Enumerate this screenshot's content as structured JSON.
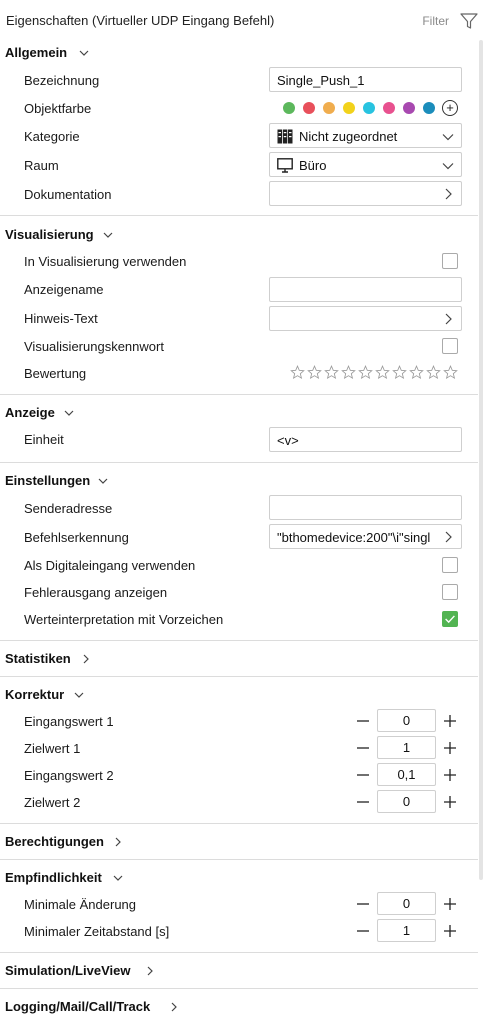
{
  "header": {
    "title": "Eigenschaften (Virtueller UDP Eingang Befehl)",
    "filter_label": "Filter"
  },
  "sections": {
    "allgemein": {
      "title": "Allgemein",
      "bezeichnung_label": "Bezeichnung",
      "bezeichnung_value": "Single_Push_1",
      "objektfarbe_label": "Objektfarbe",
      "colors": [
        "#5cb85c",
        "#e8505b",
        "#f0ad4e",
        "#f2d21b",
        "#28c3e0",
        "#e8518f",
        "#a849b0",
        "#1b8dbb"
      ],
      "kategorie_label": "Kategorie",
      "kategorie_value": "Nicht zugeordnet",
      "raum_label": "Raum",
      "raum_value": "Büro",
      "dokumentation_label": "Dokumentation"
    },
    "visualisierung": {
      "title": "Visualisierung",
      "in_vis_label": "In Visualisierung verwenden",
      "anzeigename_label": "Anzeigename",
      "hinweis_label": "Hinweis-Text",
      "kennwort_label": "Visualisierungskennwort",
      "bewertung_label": "Bewertung",
      "stars_total": 10,
      "stars_filled": 0
    },
    "anzeige": {
      "title": "Anzeige",
      "einheit_label": "Einheit",
      "einheit_value": "<v>"
    },
    "einstellungen": {
      "title": "Einstellungen",
      "senderadresse_label": "Senderadresse",
      "befehlserkennung_label": "Befehlserkennung",
      "befehlserkennung_value": "\"bthomedevice:200\"\\i\"singl",
      "digitaleingang_label": "Als Digitaleingang verwenden",
      "fehlerausgang_label": "Fehlerausgang anzeigen",
      "werteinterpretation_label": "Werteinterpretation mit Vorzeichen",
      "werteinterpretation_checked": true
    },
    "statistiken": {
      "title": "Statistiken"
    },
    "korrektur": {
      "title": "Korrektur",
      "rows": [
        {
          "label": "Eingangswert 1",
          "value": "0"
        },
        {
          "label": "Zielwert 1",
          "value": "1"
        },
        {
          "label": "Eingangswert 2",
          "value": "0,1"
        },
        {
          "label": "Zielwert 2",
          "value": "0"
        }
      ]
    },
    "berechtigungen": {
      "title": "Berechtigungen"
    },
    "empfindlichkeit": {
      "title": "Empfindlichkeit",
      "rows": [
        {
          "label": "Minimale Änderung",
          "value": "0"
        },
        {
          "label": "Minimaler Zeitabstand [s]",
          "value": "1"
        }
      ]
    },
    "simulation": {
      "title": "Simulation/LiveView"
    },
    "logging": {
      "title": "Logging/Mail/Call/Track"
    }
  },
  "stepper": {
    "minus": "−",
    "plus": "+"
  },
  "add_color_symbol": "+"
}
